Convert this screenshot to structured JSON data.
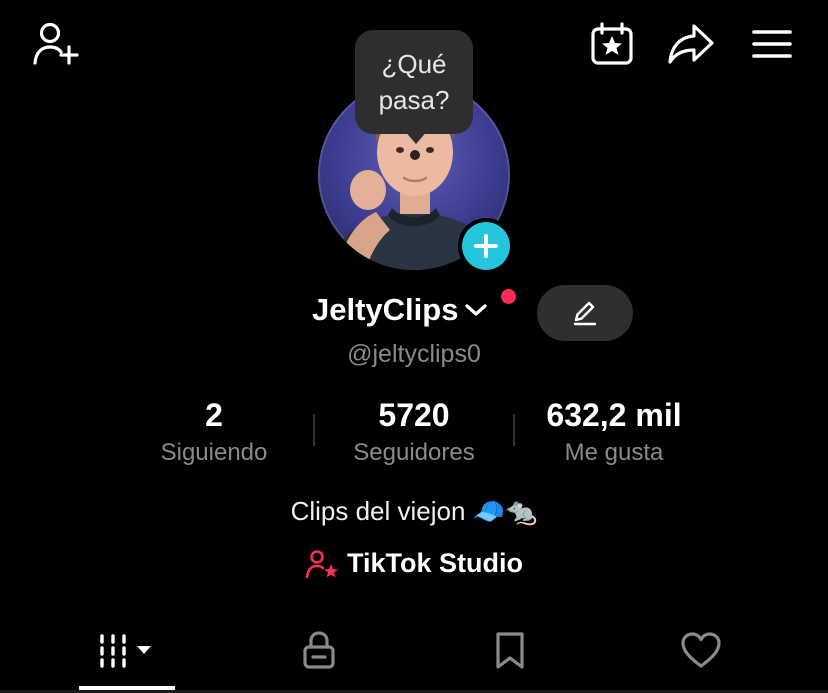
{
  "header": {
    "add_friend_icon": "person-plus-icon",
    "calendar_icon": "calendar-star-icon",
    "share_icon": "share-arrow-icon",
    "menu_icon": "hamburger-menu-icon"
  },
  "avatar": {
    "bubble_text_line1": "¿Qué",
    "bubble_text_line2": "pasa?",
    "add_icon": "plus-icon",
    "badge_color": "#25c5de"
  },
  "profile": {
    "username": "JeltyClips",
    "handle": "@jeltyclips0",
    "notification_dot_color": "#fe2c55",
    "edit_icon": "pencil-icon"
  },
  "stats": [
    {
      "value": "2",
      "label": "Siguiendo"
    },
    {
      "value": "5720",
      "label": "Seguidores"
    },
    {
      "value": "632,2 mil",
      "label": "Me gusta"
    }
  ],
  "bio": {
    "text": "Clips del viejon",
    "emoji": "🧢🐀"
  },
  "studio": {
    "label": "TikTok Studio",
    "icon": "person-star-icon",
    "icon_color": "#fe2c55"
  },
  "tabs": [
    {
      "name": "videos-tab",
      "icon": "grid-bars-icon",
      "active": true
    },
    {
      "name": "private-tab",
      "icon": "lock-icon",
      "active": false
    },
    {
      "name": "saved-tab",
      "icon": "bookmark-icon",
      "active": false
    },
    {
      "name": "liked-tab",
      "icon": "heart-icon",
      "active": false
    }
  ]
}
